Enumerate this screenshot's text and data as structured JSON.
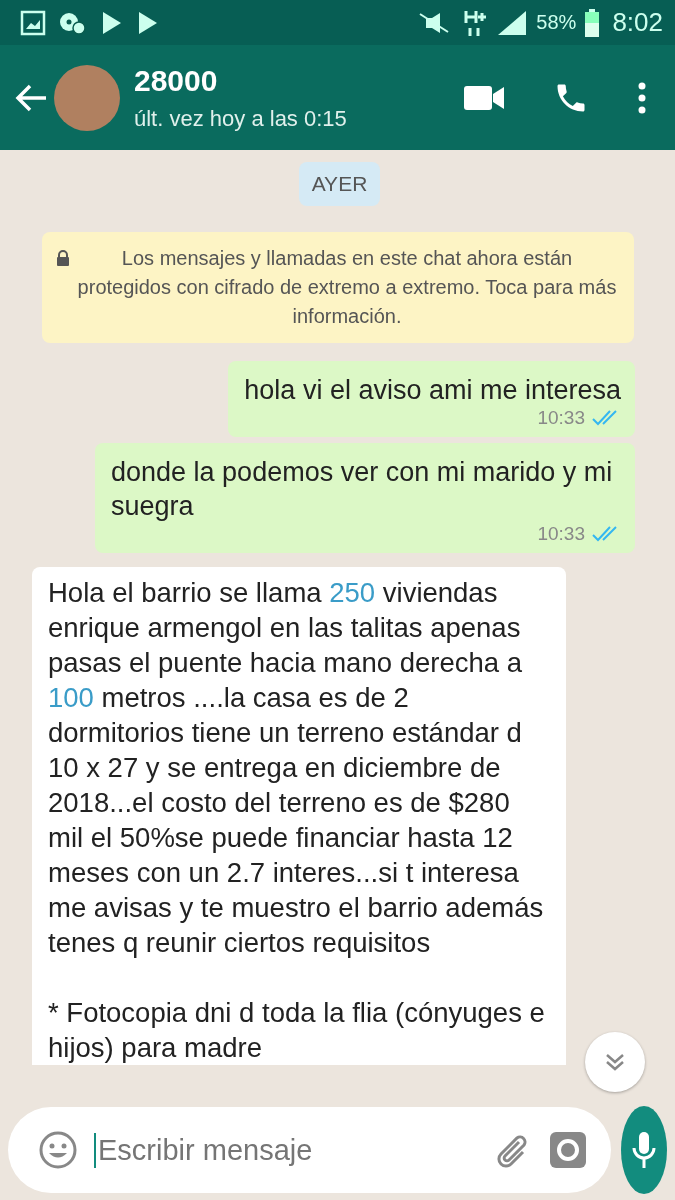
{
  "status_bar": {
    "battery": "58%",
    "time": "8:02"
  },
  "header": {
    "name": "28000",
    "last_seen": "últ. vez hoy a las 0:15"
  },
  "date_chip": "AYER",
  "notice": "Los mensajes y llamadas en este chat ahora están protegidos con cifrado de extremo a extremo. Toca para más información.",
  "messages": [
    {
      "kind": "outgoing",
      "text": "hola vi el aviso ami me interesa",
      "time": "10:33",
      "read": true
    },
    {
      "kind": "outgoing",
      "text": "donde la podemos ver con mi marido y mi suegra",
      "time": "10:33",
      "read": true
    },
    {
      "kind": "incoming",
      "paragraphs": [
        [
          {
            "kind": "plain",
            "text": "Hola el barrio se llama "
          },
          {
            "kind": "number",
            "text": "250"
          },
          {
            "kind": "plain",
            "text": " viviendas enrique armengol  en las talitas apenas pasas el puente hacia mano derecha a "
          },
          {
            "kind": "number",
            "text": "100"
          },
          {
            "kind": "plain",
            "text": " metros  ....la casa es de 2 dormitorios tiene un terreno estándar d 10 x 27 y se  entrega en diciembre de 2018...el costo del terreno es de $280 mil el 50%se puede financiar hasta 12 meses con un 2.7 interes...si t interesa me avisas y te muestro el barrio además tenes q reunir ciertos requisitos"
          }
        ],
        [
          {
            "kind": "plain",
            "text": "* Fotocopia dni d toda la flia (cónyuges e hijos) para  madre"
          }
        ]
      ]
    }
  ],
  "composer": {
    "placeholder": "Escribir mensaje"
  }
}
